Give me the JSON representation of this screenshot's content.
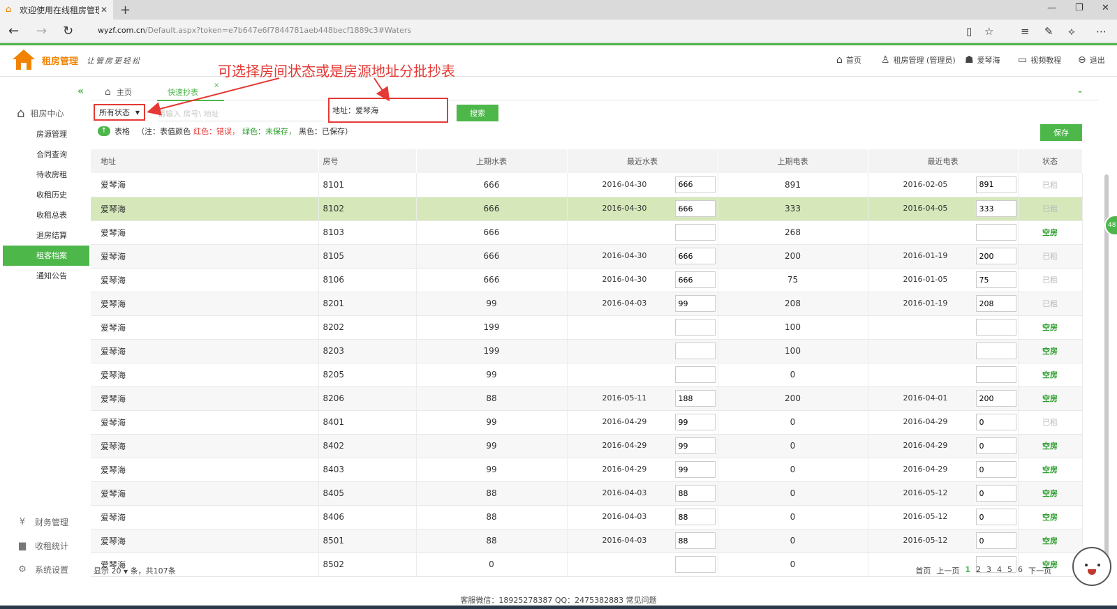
{
  "browser": {
    "tab_title": "欢迎使用在线租房管理:",
    "url_domain": "wyzf.com.cn",
    "url_path": "/Default.aspx?token=e7b647e6f7844781aeb448becf1889c3#Waters"
  },
  "header": {
    "brand": "租房管理",
    "slogan": "让管房更轻松",
    "nav": [
      {
        "icon": "home-icon",
        "label": "首页"
      },
      {
        "icon": "user-icon",
        "label": "租房管理 (管理员)"
      },
      {
        "icon": "org-icon",
        "label": "爱琴海"
      },
      {
        "icon": "video-icon",
        "label": "视频教程"
      },
      {
        "icon": "logout-icon",
        "label": "退出"
      }
    ]
  },
  "annotation": "可选择房间状态或是房源地址分批抄表",
  "sidebar": {
    "section": "租房中心",
    "items": [
      "房源管理",
      "合同查询",
      "待收房租",
      "收租历史",
      "收租总表",
      "退房结算",
      "租客档案",
      "通知公告"
    ],
    "active_index": 6,
    "bottom": [
      {
        "icon": "yen-icon",
        "label": "财务管理"
      },
      {
        "icon": "bar-chart-icon",
        "label": "收租统计"
      },
      {
        "icon": "gear-icon",
        "label": "系统设置"
      }
    ]
  },
  "tabs": {
    "home": "主页",
    "active": "快速抄表",
    "close": "×"
  },
  "filters": {
    "state_label": "所有状态",
    "query_placeholder": "请输入 房号\\ 地址",
    "address_label": "地址：",
    "address_value": "爱琴海",
    "search_label": "搜索",
    "save_label": "保存"
  },
  "legend": {
    "table_label": "表格",
    "note_prefix": "（注：表值颜色",
    "red": "红色：错误，",
    "green": "绿色：未保存，",
    "black": "黑色：已保存",
    "note_suffix": "）"
  },
  "table": {
    "headers": [
      "地址",
      "房号",
      "上期水表",
      "最近水表",
      "上期电表",
      "最近电表",
      "状态"
    ],
    "rows": [
      {
        "addr": "爱琴海",
        "room": "8101",
        "pw": "666",
        "wdate": "2016-04-30",
        "w": "666",
        "pe": "891",
        "edate": "2016-02-05",
        "e": "891",
        "state": "已租"
      },
      {
        "addr": "爱琴海",
        "room": "8102",
        "pw": "666",
        "wdate": "2016-04-30",
        "w": "666",
        "pe": "333",
        "edate": "2016-04-05",
        "e": "333",
        "state": "已租"
      },
      {
        "addr": "爱琴海",
        "room": "8103",
        "pw": "666",
        "wdate": "",
        "w": "",
        "pe": "268",
        "edate": "",
        "e": "",
        "state": "空房"
      },
      {
        "addr": "爱琴海",
        "room": "8105",
        "pw": "666",
        "wdate": "2016-04-30",
        "w": "666",
        "pe": "200",
        "edate": "2016-01-19",
        "e": "200",
        "state": "已租"
      },
      {
        "addr": "爱琴海",
        "room": "8106",
        "pw": "666",
        "wdate": "2016-04-30",
        "w": "666",
        "pe": "75",
        "edate": "2016-01-05",
        "e": "75",
        "state": "已租"
      },
      {
        "addr": "爱琴海",
        "room": "8201",
        "pw": "99",
        "wdate": "2016-04-03",
        "w": "99",
        "pe": "208",
        "edate": "2016-01-19",
        "e": "208",
        "state": "已租"
      },
      {
        "addr": "爱琴海",
        "room": "8202",
        "pw": "199",
        "wdate": "",
        "w": "",
        "pe": "100",
        "edate": "",
        "e": "",
        "state": "空房"
      },
      {
        "addr": "爱琴海",
        "room": "8203",
        "pw": "199",
        "wdate": "",
        "w": "",
        "pe": "100",
        "edate": "",
        "e": "",
        "state": "空房"
      },
      {
        "addr": "爱琴海",
        "room": "8205",
        "pw": "99",
        "wdate": "",
        "w": "",
        "pe": "0",
        "edate": "",
        "e": "",
        "state": "空房"
      },
      {
        "addr": "爱琴海",
        "room": "8206",
        "pw": "88",
        "wdate": "2016-05-11",
        "w": "188",
        "pe": "200",
        "edate": "2016-04-01",
        "e": "200",
        "state": "空房"
      },
      {
        "addr": "爱琴海",
        "room": "8401",
        "pw": "99",
        "wdate": "2016-04-29",
        "w": "99",
        "pe": "0",
        "edate": "2016-04-29",
        "e": "0",
        "state": "已租"
      },
      {
        "addr": "爱琴海",
        "room": "8402",
        "pw": "99",
        "wdate": "2016-04-29",
        "w": "99",
        "pe": "0",
        "edate": "2016-04-29",
        "e": "0",
        "state": "空房"
      },
      {
        "addr": "爱琴海",
        "room": "8403",
        "pw": "99",
        "wdate": "2016-04-29",
        "w": "99",
        "pe": "0",
        "edate": "2016-04-29",
        "e": "0",
        "state": "空房"
      },
      {
        "addr": "爱琴海",
        "room": "8405",
        "pw": "88",
        "wdate": "2016-04-03",
        "w": "88",
        "pe": "0",
        "edate": "2016-05-12",
        "e": "0",
        "state": "空房"
      },
      {
        "addr": "爱琴海",
        "room": "8406",
        "pw": "88",
        "wdate": "2016-04-03",
        "w": "88",
        "pe": "0",
        "edate": "2016-05-12",
        "e": "0",
        "state": "空房"
      },
      {
        "addr": "爱琴海",
        "room": "8501",
        "pw": "88",
        "wdate": "2016-04-03",
        "w": "88",
        "pe": "0",
        "edate": "2016-05-12",
        "e": "0",
        "state": "空房"
      },
      {
        "addr": "爱琴海",
        "room": "8502",
        "pw": "0",
        "wdate": "",
        "w": "",
        "pe": "0",
        "edate": "",
        "e": "",
        "state": "空房"
      }
    ],
    "selected_index": 1
  },
  "footer": {
    "show_prefix": "显示",
    "page_size": "20",
    "show_suffix": "条，共107条",
    "pager": [
      "首页",
      "上一页",
      "1",
      "2",
      "3",
      "4",
      "5",
      "6",
      "下一页"
    ],
    "current_page": "1"
  },
  "site_footer": "客服微信：18925278387  QQ：2475382883    常见问题",
  "side_badge": "48",
  "colors": {
    "accent": "#4db74a",
    "brand": "#f08300",
    "error": "#e53935"
  }
}
